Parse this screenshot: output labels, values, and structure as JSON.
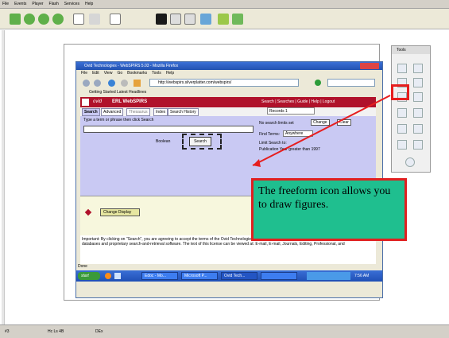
{
  "menubar": {
    "items": [
      "File",
      "Events",
      "Player",
      "Flash",
      "Services",
      "Help"
    ]
  },
  "slide": {
    "browser": {
      "title": "Ovid Technologies - WebSPIRS 5.03 - Mozilla Firefox",
      "menu": [
        "File",
        "Edit",
        "View",
        "Go",
        "Bookmarks",
        "Tools",
        "Help"
      ],
      "url": "http://webspirs.silverplatter.com/webspirs/",
      "bookmarks": "Getting Started    Latest Headlines",
      "ovid_label": "ovid",
      "product": "ERL WebSPIRS",
      "top_links": "Search | Searches | Guide | Help | Logout",
      "tabs": [
        "Search",
        "Advanced",
        "Thesaurus",
        "Index",
        "Search History"
      ],
      "prompt": "Type a term or phrase then click Search",
      "boolean_button": "Boolean",
      "search_button": "Search",
      "records_select": "Records 1",
      "no_limits": "No search limits set",
      "change_button": "Change",
      "clear_button": "Clear",
      "find_terms_label": "Find Terms:",
      "find_terms_value": "Anywhere",
      "limit_label": "Limit Search to:",
      "publication_label": "Publication Year greater than 1997",
      "change_display": "Change Display",
      "legal": "Important: By clicking on \"Search\", you are agreeing to accept the terms of the Ovid Technologies License Agreement, which governs your use of Ovid Technologies databases and proprietary search-and-retrieval software. The text of this license can be viewed at: E-mail, E-mail, Journals, Editing, Professional, and",
      "done": "Done",
      "taskbar": {
        "start": "start",
        "tasks": [
          "Edoc - Mo...",
          "Microsoft P...",
          "Ovid Tech...",
          ""
        ],
        "clock": "7:56 AM"
      }
    }
  },
  "tools": {
    "title": "Tools"
  },
  "callout": {
    "text": "The freeform icon allows you to draw figures."
  },
  "statusbar": {
    "items": [
      "#3",
      "Hc Ls 4B",
      "DEx"
    ]
  },
  "colors": {
    "callout_fill": "#1fbf8f",
    "highlight": "#e61e1e",
    "ovid_red": "#b0122b"
  }
}
